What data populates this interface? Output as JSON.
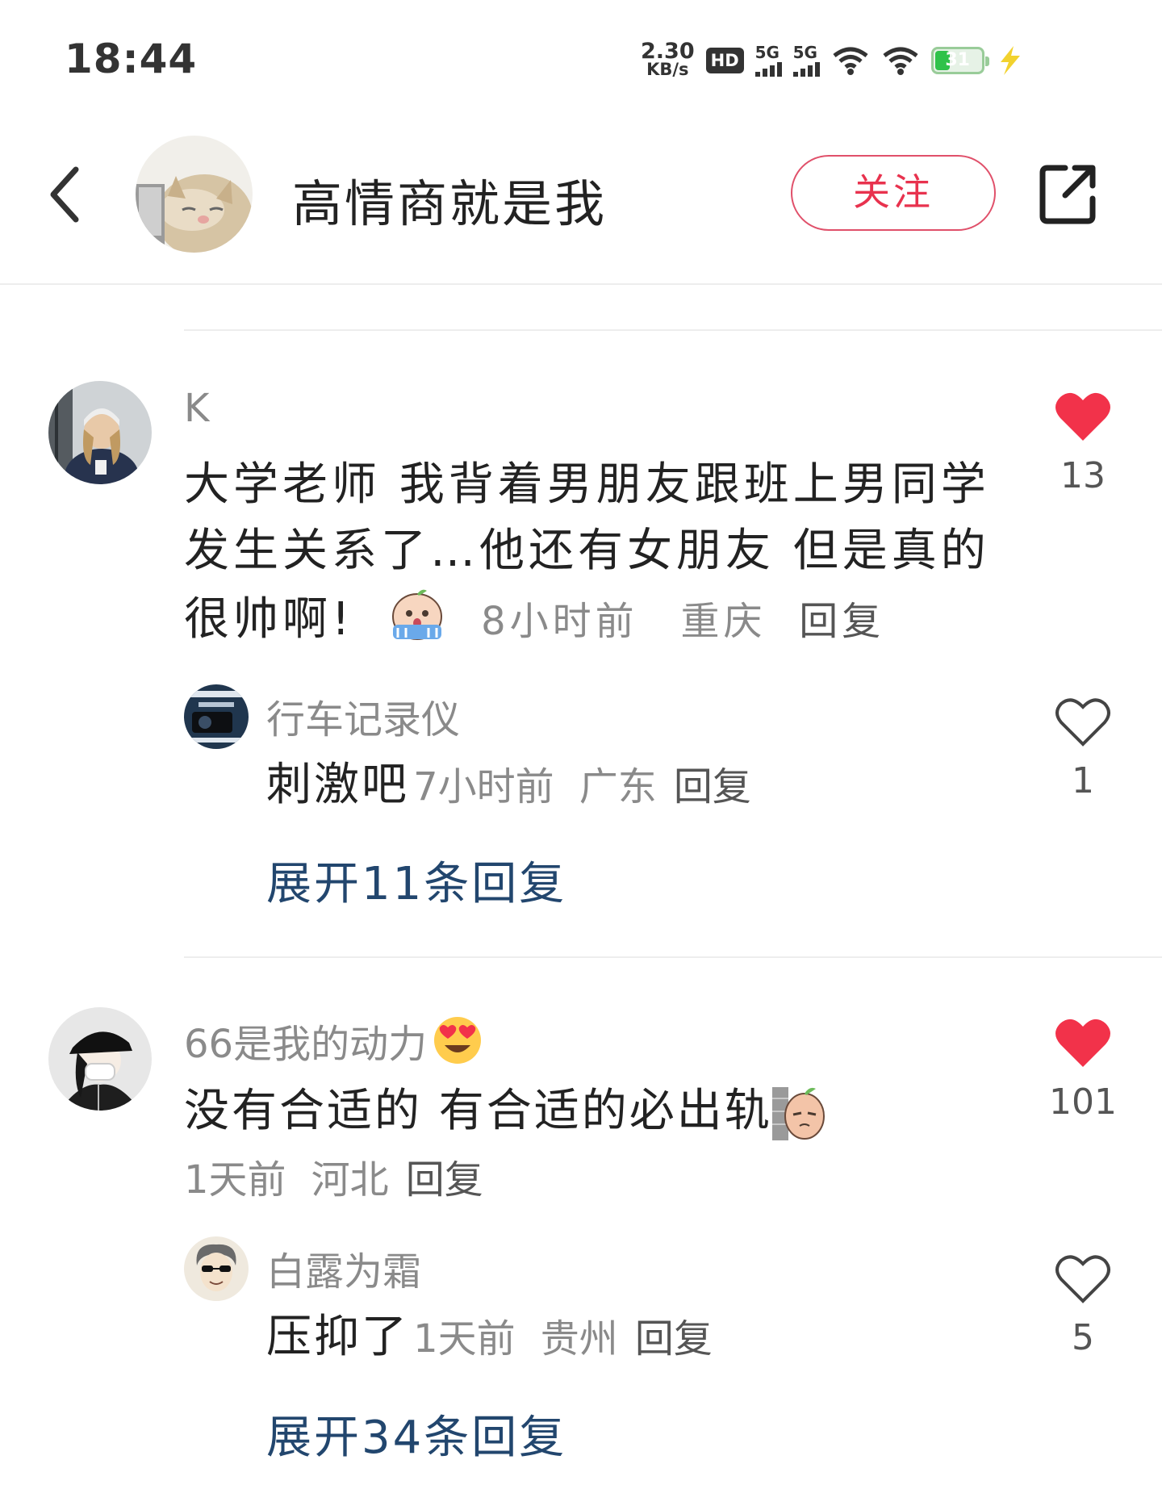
{
  "status_bar": {
    "time": "18:44",
    "net_speed_value": "2.30",
    "net_speed_unit": "KB/s",
    "hd_label": "HD",
    "sim1_type": "5G",
    "sim2_type": "5G",
    "battery_percent": "31",
    "battery_level": 0.31
  },
  "header": {
    "title": "高情商就是我",
    "follow_label": "关注",
    "back_icon": "chevron-left-icon",
    "share_icon": "share-external-icon"
  },
  "comments": [
    {
      "username": "K",
      "text": "大学老师 我背着男朋友跟班上男同学发生关系了…他还有女朋友 但是真的很帅啊!",
      "emoji": "crying-emoji-sticker",
      "time": "8小时前",
      "location": "重庆",
      "reply_label": "回复",
      "likes": "13",
      "liked": true,
      "replies": [
        {
          "username": "行车记录仪",
          "text": "刺激吧",
          "time": "7小时前",
          "location": "广东",
          "reply_label": "回复",
          "likes": "1",
          "liked": false
        }
      ],
      "expand_label": "展开11条回复"
    },
    {
      "username": "66是我的动力",
      "username_emoji": "heart-eyes-emoji",
      "text": "没有合适的 有合适的必出轨",
      "emoji": "peeking-wall-emoji-sticker",
      "time": "1天前",
      "location": "河北",
      "reply_label": "回复",
      "likes": "101",
      "liked": true,
      "replies": [
        {
          "username": "白露为霜",
          "text": "压抑了",
          "time": "1天前",
          "location": "贵州",
          "reply_label": "回复",
          "likes": "5",
          "liked": false
        }
      ],
      "expand_label": "展开34条回复"
    }
  ],
  "colors": {
    "like_red": "#f2324a",
    "follow_red": "#e8324e",
    "expand_blue": "#22466e"
  }
}
